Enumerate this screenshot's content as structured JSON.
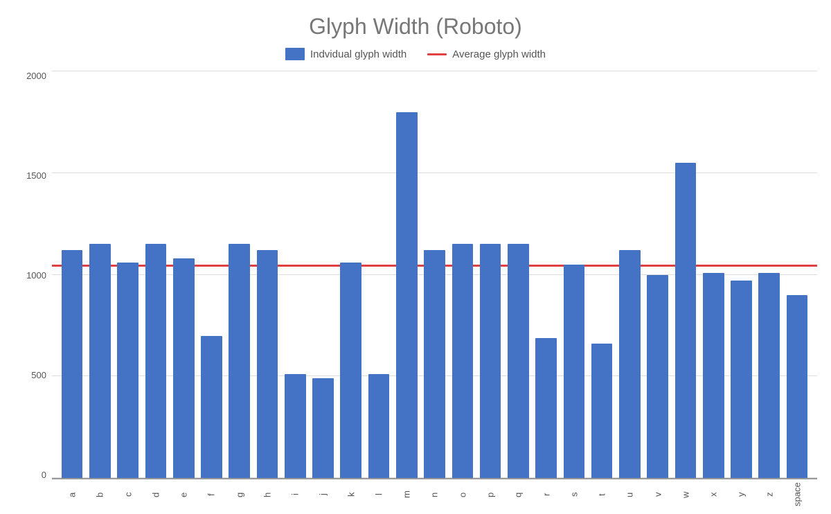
{
  "title": "Glyph Width (Roboto)",
  "legend": {
    "bar_label": "Indvidual glyph width",
    "line_label": "Average glyph width"
  },
  "y_axis": {
    "labels": [
      "0",
      "500",
      "1000",
      "1500",
      "2000"
    ],
    "max": 2000
  },
  "average": 1040,
  "bars": [
    {
      "label": "a",
      "value": 1120
    },
    {
      "label": "b",
      "value": 1150
    },
    {
      "label": "c",
      "value": 1060
    },
    {
      "label": "d",
      "value": 1150
    },
    {
      "label": "e",
      "value": 1080
    },
    {
      "label": "f",
      "value": 700
    },
    {
      "label": "g",
      "value": 1150
    },
    {
      "label": "h",
      "value": 1120
    },
    {
      "label": "i",
      "value": 510
    },
    {
      "label": "j",
      "value": 490
    },
    {
      "label": "k",
      "value": 1060
    },
    {
      "label": "l",
      "value": 510
    },
    {
      "label": "m",
      "value": 1800
    },
    {
      "label": "n",
      "value": 1120
    },
    {
      "label": "o",
      "value": 1150
    },
    {
      "label": "p",
      "value": 1150
    },
    {
      "label": "q",
      "value": 1150
    },
    {
      "label": "r",
      "value": 690
    },
    {
      "label": "s",
      "value": 1050
    },
    {
      "label": "t",
      "value": 660
    },
    {
      "label": "u",
      "value": 1120
    },
    {
      "label": "v",
      "value": 1000
    },
    {
      "label": "w",
      "value": 1550
    },
    {
      "label": "x",
      "value": 1010
    },
    {
      "label": "y",
      "value": 970
    },
    {
      "label": "z",
      "value": 1010
    },
    {
      "label": "space",
      "value": 900
    }
  ],
  "colors": {
    "bar": "#4472C4",
    "avg_line": "#E04040",
    "title": "#888",
    "axis": "#555",
    "grid": "#ddd"
  }
}
